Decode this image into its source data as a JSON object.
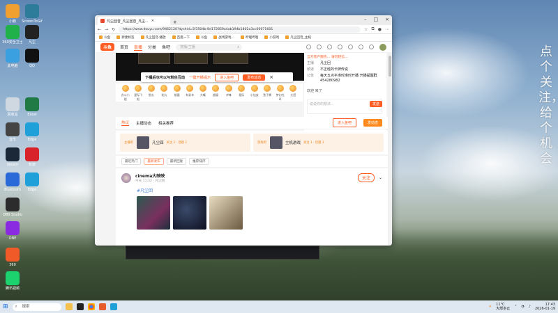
{
  "wallpaper_text": "点个关注，给个机会",
  "desktop_icons": [
    {
      "label": "小鹅",
      "color": "#f0a030"
    },
    {
      "label": "ScreenToGif",
      "color": "#2d7d9a"
    },
    {
      "label": "360安全卫士",
      "color": "#21b14a"
    },
    {
      "label": "凡尘",
      "color": "#222222"
    },
    {
      "label": "此电脑",
      "color": "#3aa0e0"
    },
    {
      "label": "QQ",
      "color": "#111111"
    },
    {
      "label": "回收站",
      "color": "#cfd8e0"
    },
    {
      "label": "Excel",
      "color": "#1f7a46"
    },
    {
      "label": "音乐",
      "color": "#444444"
    },
    {
      "label": "Edge",
      "color": "#1fa0d8"
    },
    {
      "label": "Steam",
      "color": "#1b2838"
    },
    {
      "label": "有道",
      "color": "#d8232a"
    },
    {
      "label": "Bluetooth",
      "color": "#2a6ad8"
    },
    {
      "label": "Edge",
      "color": "#1fa0d8"
    },
    {
      "label": "OBS Studio",
      "color": "#2c2c2c"
    },
    {
      "label": "ONE",
      "color": "#8a2be2"
    },
    {
      "label": "360",
      "color": "#f05a28"
    },
    {
      "label": "腾讯视频",
      "color": "#1bd26e"
    }
  ],
  "browser": {
    "tab_title": "凡尘回音_凡尘回音_凡尘...",
    "url": "https://www.douyu.com/9462120?dyshid=5f3504b-8d172859a4ab194b1802a3cc00071601",
    "bookmarks": [
      "斗鱼",
      "新建标签",
      "凡尘回音·播放",
      "百度一下",
      "斗鱼",
      "战场游戏...",
      "哔哩哔哩",
      "小游戏",
      "凡尘回音_主机"
    ],
    "site": {
      "logo": "斗鱼",
      "nav": [
        "首页",
        "直播",
        "分类",
        "鱼吧"
      ],
      "search_placeholder": "搜播/主播"
    }
  },
  "popup": {
    "text": "下播后也可以与粉丝互动",
    "link": "一键开播提示",
    "btn1": "进入鱼吧",
    "btn2": "发布动态"
  },
  "chat_panel": {
    "notice": "当方客户服务... 请勿轻信...",
    "rows": [
      {
        "key": "主播",
        "val": "凡尘回"
      },
      {
        "key": "频道",
        "val": "不正经的卡牌传说"
      },
      {
        "key": "公告",
        "val": "每天五点半准时准时开播 开播提醒群 454280982"
      }
    ],
    "input_placeholder": "说说你的想法...",
    "send_label": "发送",
    "welcome": "欢迎 来了"
  },
  "gifts": [
    "办公小姐",
    "星际飞船",
    "鱼丸",
    "花丸",
    "能量",
    "有彩车",
    "大嘴",
    "超级",
    "冲锋",
    "星际",
    "小仙女",
    "鱼子酱",
    "梦幻光环",
    "大招"
  ],
  "tabs": {
    "items": [
      "热议",
      "主播动态",
      "相关推荐"
    ],
    "active": 0,
    "btn_fish": "进入鱼吧",
    "btn_post": "发动态"
  },
  "cards": [
    {
      "tag": "主播吧",
      "title": "凡尘回",
      "sub": "关注 2 · 话题 2"
    },
    {
      "tag": "游戏吧",
      "title": "主机游戏",
      "sub": "关注 1 · 话题 3"
    }
  ],
  "filters": {
    "items": [
      "最近热门",
      "最新发布",
      "最新回复",
      "推荐排序"
    ],
    "active": 1
  },
  "post": {
    "author": "cinema大映映",
    "time": "今天 11:32 · 凡尘回",
    "topic": "#凡尘回",
    "follow": "关注"
  },
  "taskbar": {
    "search_placeholder": "搜索",
    "weather": "11°C",
    "weather_sub": "大部多云",
    "time": "17:43",
    "date": "2026-01-19"
  }
}
